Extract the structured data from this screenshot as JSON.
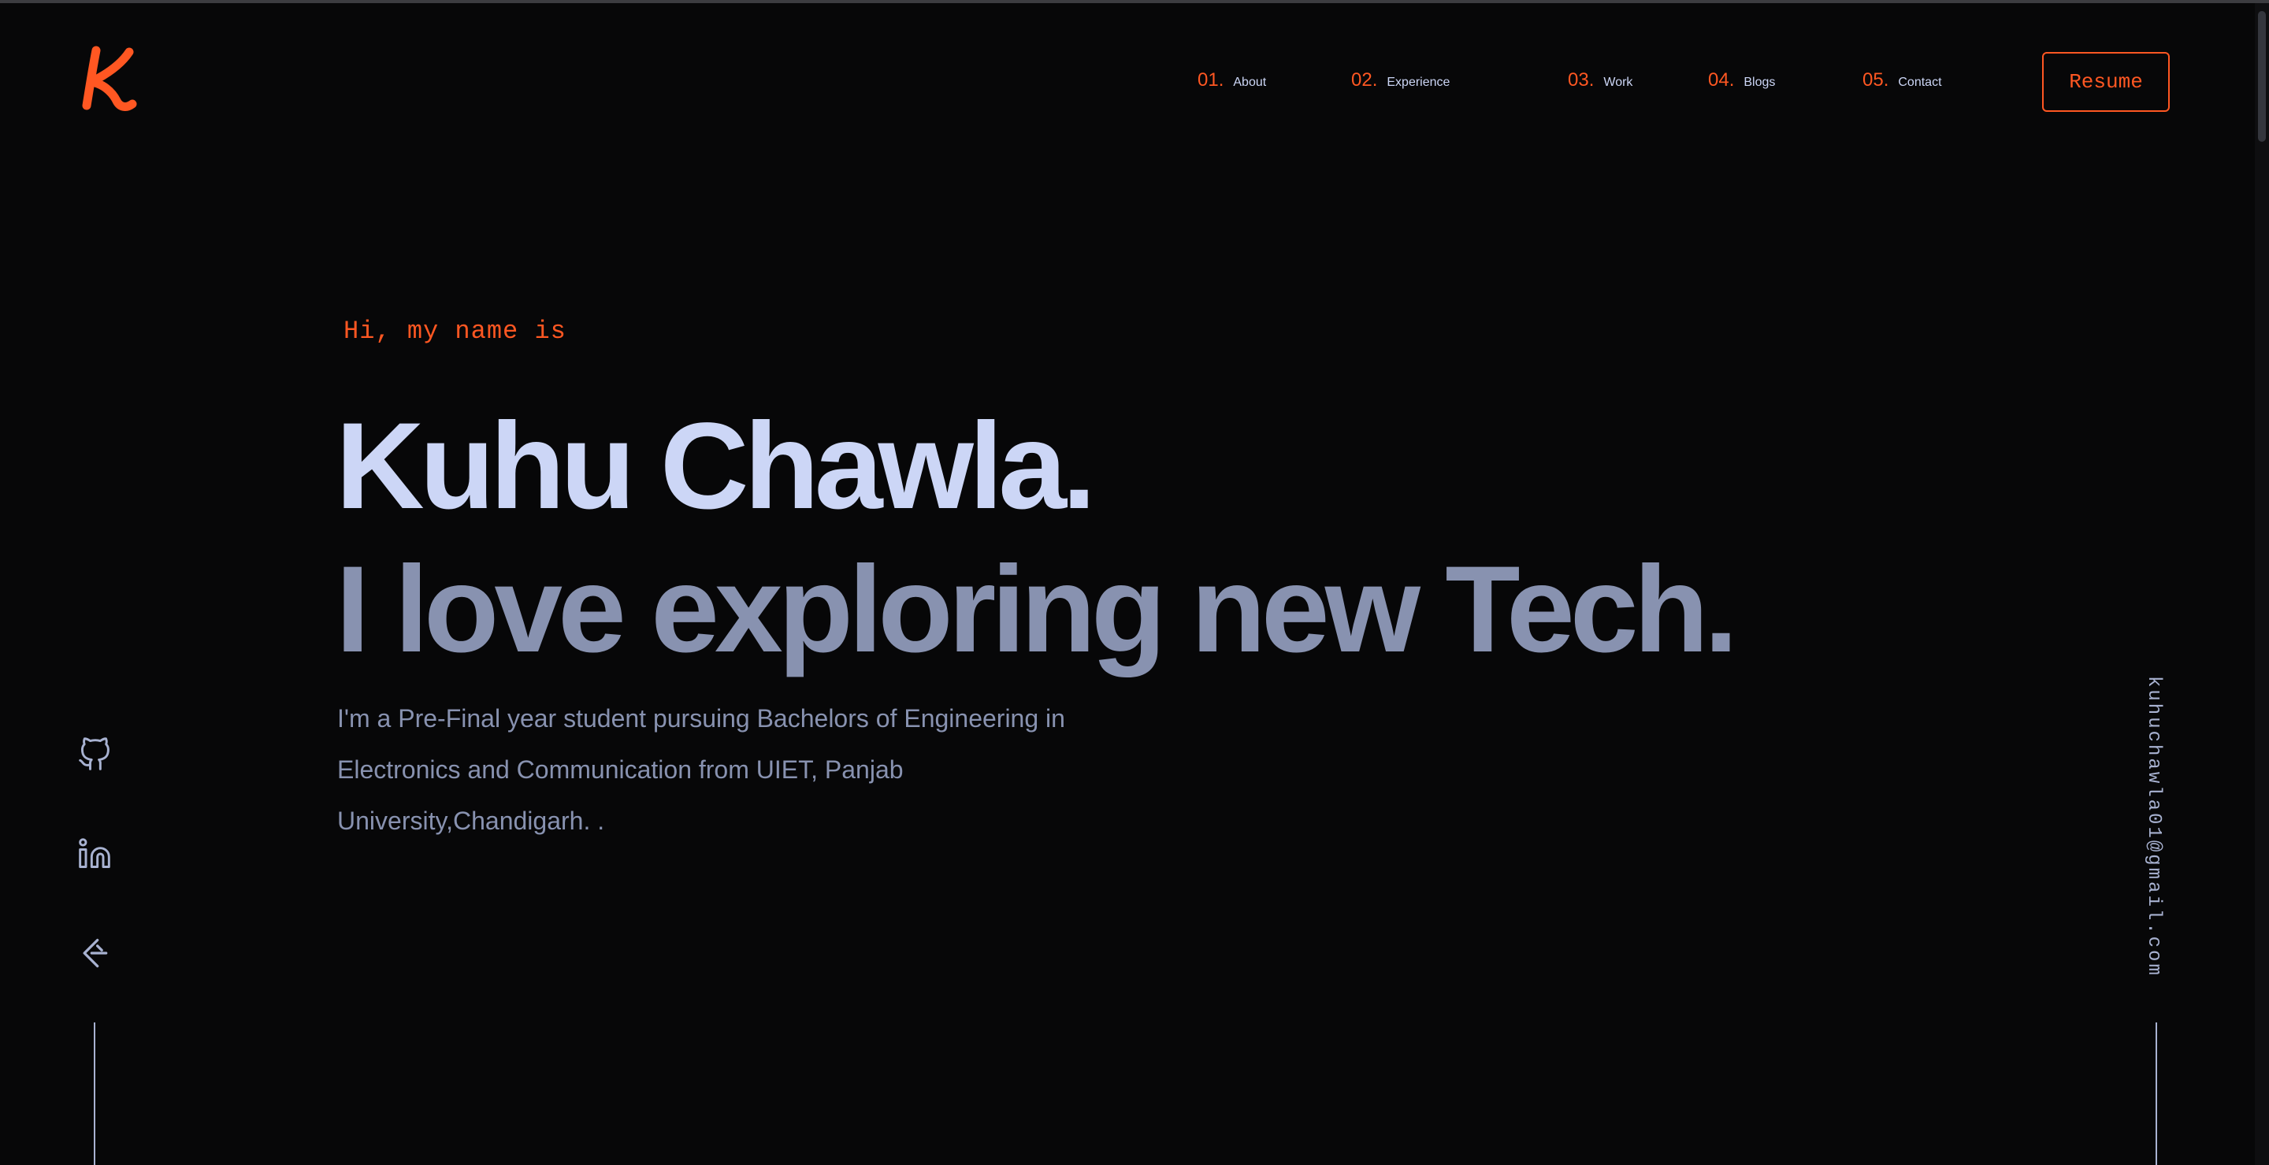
{
  "brand": {
    "logo_letter": "K",
    "accent_color": "#ff5722"
  },
  "nav": {
    "items": [
      {
        "num": "01.",
        "label": "About"
      },
      {
        "num": "02.",
        "label": "Experience"
      },
      {
        "num": "03.",
        "label": "Work"
      },
      {
        "num": "04.",
        "label": "Blogs"
      },
      {
        "num": "05.",
        "label": "Contact"
      }
    ],
    "resume_label": "Resume"
  },
  "hero": {
    "greeting": "Hi, my name is",
    "name": "Kuhu Chawla.",
    "tagline": "I love exploring new Tech.",
    "bio": "I'm a Pre-Final year student pursuing Bachelors of Engineering in Electronics and Communication from UIET, Panjab University,Chandigarh. ."
  },
  "social": {
    "icons": [
      "github-icon",
      "linkedin-icon",
      "leetcode-icon"
    ]
  },
  "email": "kuhuchawla01@gmail.com",
  "colors": {
    "background": "#070708",
    "heading": "#ccd6f6",
    "text": "#8892b0",
    "accent": "#ff5722"
  }
}
